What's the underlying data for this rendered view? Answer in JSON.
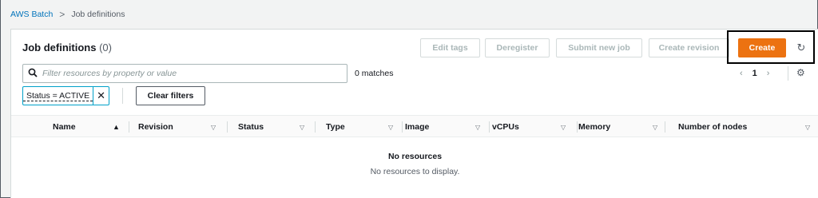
{
  "breadcrumb": {
    "root": "AWS Batch",
    "separator": ">",
    "current": "Job definitions"
  },
  "panel": {
    "title": "Job definitions",
    "count": "(0)"
  },
  "actions": {
    "edit_tags": "Edit tags",
    "deregister": "Deregister",
    "submit_new_job": "Submit new job",
    "create_revision": "Create revision",
    "create": "Create",
    "refresh_icon": "↻"
  },
  "search": {
    "placeholder": "Filter resources by property or value",
    "value": "",
    "matches": "0 matches"
  },
  "pagination": {
    "prev": "‹",
    "page": "1",
    "next": "›",
    "settings_icon": "⚙"
  },
  "filter": {
    "token": "Status = ACTIVE",
    "remove": "✕",
    "clear": "Clear filters"
  },
  "table": {
    "columns": [
      "Name",
      "Revision",
      "Status",
      "Type",
      "Image",
      "vCPUs",
      "Memory",
      "Number of nodes"
    ],
    "sort_active": "▲",
    "sort_inactive": "▽",
    "rows": []
  },
  "empty": {
    "title": "No resources",
    "description": "No resources to display."
  },
  "colors": {
    "primary": "#ec7211",
    "link": "#0073bb",
    "token_border": "#00a1c9"
  }
}
